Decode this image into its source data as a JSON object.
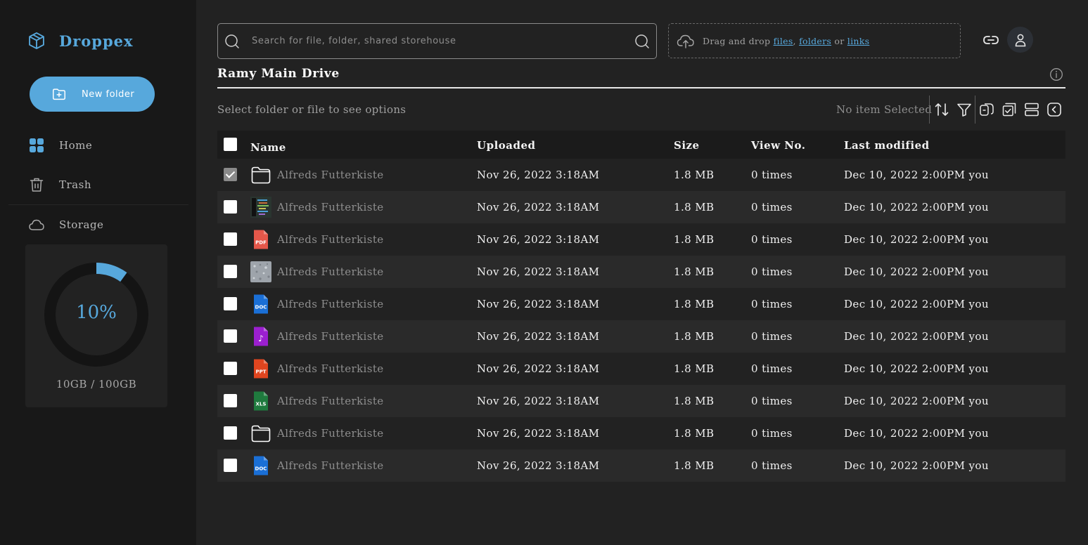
{
  "brand": {
    "name": "Droppex",
    "icon": "cube-icon"
  },
  "sidebar": {
    "new_folder_label": "New folder",
    "nav": [
      {
        "label": "Home",
        "icon": "grid-icon"
      },
      {
        "label": "Trash",
        "icon": "trash-icon"
      },
      {
        "label": "Storage",
        "icon": "cloud-icon"
      }
    ],
    "storage": {
      "percent_label": "10%",
      "used_fraction": 0.1,
      "amount": "10GB / 100GB"
    }
  },
  "search": {
    "placeholder": "Search for file, folder, shared storehouse"
  },
  "dropzone": {
    "prefix": "Drag and drop ",
    "files": "files",
    "comma": ", ",
    "folders": "folders",
    "or": " or ",
    "links": "links"
  },
  "drive": {
    "title": "Ramy Main Drive"
  },
  "toolbar": {
    "hint": "Select folder or file to see options",
    "selection_status": "No item Selected",
    "tools": [
      "sort-icon",
      "filter-icon",
      "copy-icon",
      "select-all-icon",
      "layout-icon",
      "collapse-icon"
    ]
  },
  "table": {
    "headers": {
      "name": "Name",
      "uploaded": "Uploaded",
      "size": "Size",
      "views": "View No.",
      "modified": "Last modified"
    },
    "rows": [
      {
        "type": "folder",
        "name": "Alfreds Futterkiste",
        "uploaded": "Nov 26, 2022 3:18AM",
        "size": "1.8 MB",
        "views": "0 times",
        "modified": "Dec 10, 2022 2:00PM you",
        "checked": true
      },
      {
        "type": "image-code",
        "name": "Alfreds Futterkiste",
        "uploaded": "Nov 26, 2022 3:18AM",
        "size": "1.8 MB",
        "views": "0 times",
        "modified": "Dec 10, 2022 2:00PM you",
        "checked": false
      },
      {
        "type": "pdf",
        "badge": "PDF",
        "name": "Alfreds Futterkiste",
        "uploaded": "Nov 26, 2022 3:18AM",
        "size": "1.8 MB",
        "views": "0 times",
        "modified": "Dec 10, 2022 2:00PM you",
        "checked": false
      },
      {
        "type": "image-texture",
        "name": "Alfreds Futterkiste",
        "uploaded": "Nov 26, 2022 3:18AM",
        "size": "1.8 MB",
        "views": "0 times",
        "modified": "Dec 10, 2022 2:00PM you",
        "checked": false
      },
      {
        "type": "doc",
        "badge": "DOC",
        "name": "Alfreds Futterkiste",
        "uploaded": "Nov 26, 2022 3:18AM",
        "size": "1.8 MB",
        "views": "0 times",
        "modified": "Dec 10, 2022 2:00PM you",
        "checked": false
      },
      {
        "type": "audio",
        "badge": "♪",
        "name": "Alfreds Futterkiste",
        "uploaded": "Nov 26, 2022 3:18AM",
        "size": "1.8 MB",
        "views": "0 times",
        "modified": "Dec 10, 2022 2:00PM you",
        "checked": false
      },
      {
        "type": "ppt",
        "badge": "PPT",
        "name": "Alfreds Futterkiste",
        "uploaded": "Nov 26, 2022 3:18AM",
        "size": "1.8 MB",
        "views": "0 times",
        "modified": "Dec 10, 2022 2:00PM you",
        "checked": false
      },
      {
        "type": "xls",
        "badge": "XLS",
        "name": "Alfreds Futterkiste",
        "uploaded": "Nov 26, 2022 3:18AM",
        "size": "1.8 MB",
        "views": "0 times",
        "modified": "Dec 10, 2022 2:00PM you",
        "checked": false
      },
      {
        "type": "folder",
        "name": "Alfreds Futterkiste",
        "uploaded": "Nov 26, 2022 3:18AM",
        "size": "1.8 MB",
        "views": "0 times",
        "modified": "Dec 10, 2022 2:00PM you",
        "checked": false
      },
      {
        "type": "doc",
        "badge": "DOC",
        "name": "Alfreds Futterkiste",
        "uploaded": "Nov 26, 2022 3:18AM",
        "size": "1.8 MB",
        "views": "0 times",
        "modified": "Dec 10, 2022 2:00PM you",
        "checked": false
      }
    ]
  },
  "colors": {
    "accent": "#57a8dc",
    "pdf": "#e5574a",
    "doc": "#1a6fd6",
    "audio": "#9b1fcf",
    "ppt": "#e0451f",
    "xls": "#1f7a3e"
  }
}
